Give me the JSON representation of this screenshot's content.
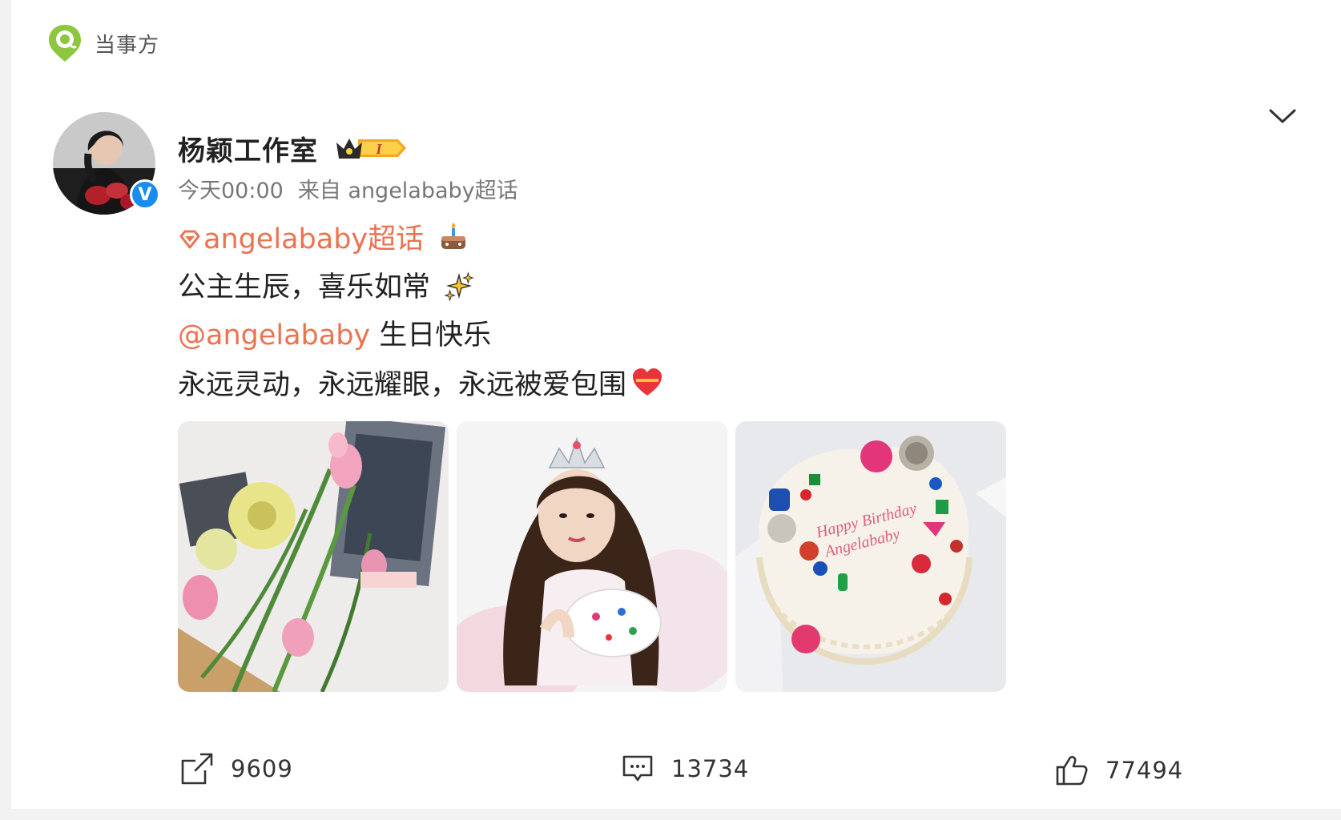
{
  "source_tag": {
    "label": "当事方",
    "icon": "location-pin-icon",
    "color": "#8dc63f"
  },
  "post": {
    "author": {
      "name": "杨颖工作室",
      "verified": true,
      "vip_badge_text": "I"
    },
    "time": "今天00:00",
    "source": "来自 angelababy超话",
    "topic": "angelababy超话",
    "text_lines": [
      "公主生辰，喜乐如常",
      "生日快乐",
      "永远灵动，永远耀眼，永远被爱包围"
    ],
    "mention": "@angelababy",
    "images": [
      {
        "name": "flowers-photo"
      },
      {
        "name": "princess-portrait-photo"
      },
      {
        "name": "birthday-cake-photo",
        "cake_text": [
          "Happy Birthday",
          "Angelababy"
        ]
      }
    ]
  },
  "actions": {
    "share_count": "9609",
    "comment_count": "13734",
    "like_count": "77494"
  },
  "colors": {
    "accent": "#eb7350",
    "verified_blue": "#1a8cf0"
  }
}
